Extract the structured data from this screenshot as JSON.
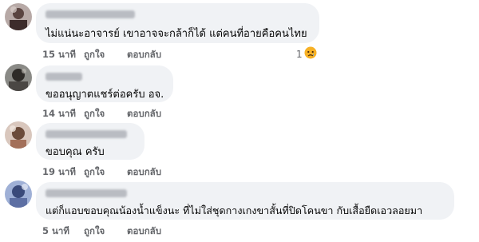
{
  "comments": [
    {
      "text": "ไม่แน่นะอาจารย์ เขาอาจจะกล้าก็ได้ แต่คนที่อายคือคนไทย",
      "time": "15 นาที",
      "like_label": "ถูกใจ",
      "reply_label": "ตอบกลับ",
      "reaction_count": "1",
      "reaction_icon": "sad-face-icon"
    },
    {
      "text": "ขออนุญาตแชร์ต่อครับ อจ.",
      "time": "14 นาที",
      "like_label": "ถูกใจ",
      "reply_label": "ตอบกลับ"
    },
    {
      "text": "ขอบคุณ ครับ",
      "time": "19 นาที",
      "like_label": "ถูกใจ",
      "reply_label": "ตอบกลับ"
    },
    {
      "text": "แต่ก็แอบขอบคุณน้องน้ำแข็งนะ ที่ไม่ใส่ชุดกางเกงขาสั้นที่ปิดโคนขา กับเสื้อยืดเอวลอยมา",
      "time": "5 นาที",
      "like_label": "ถูกใจ",
      "reply_label": "ตอบกลับ"
    }
  ],
  "colors": {
    "bubble": "#f0f2f5",
    "meta_text": "#65676b",
    "body_text": "#050505",
    "sad_emoji": "#f7b125"
  }
}
